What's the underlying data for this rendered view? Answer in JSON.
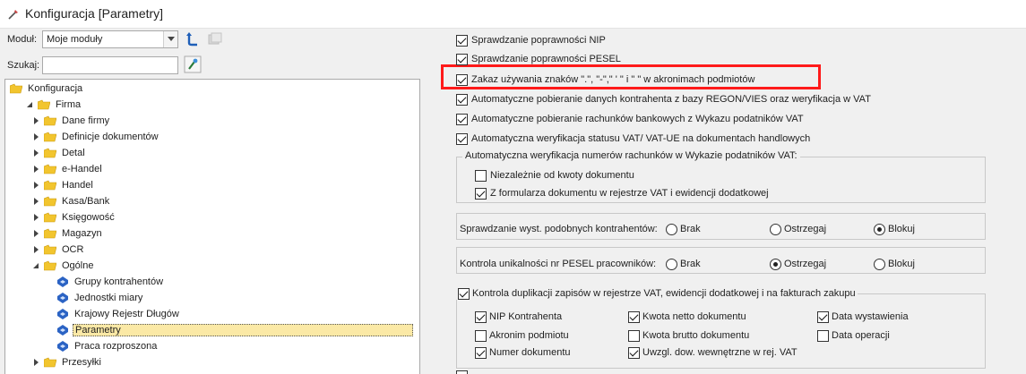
{
  "window": {
    "title": "Konfiguracja [Parametry]"
  },
  "toolbar": {
    "modul_label": "Moduł:",
    "modul_value": "Moje moduły",
    "szukaj_label": "Szukaj:",
    "szukaj_value": ""
  },
  "tree": {
    "items": [
      {
        "label": "Konfiguracja",
        "level": 0,
        "expander": "none",
        "icon": "folder"
      },
      {
        "label": "Firma",
        "level": 1,
        "expander": "expanded",
        "icon": "folder"
      },
      {
        "label": "Dane firmy",
        "level": 2,
        "expander": "collapsed",
        "icon": "folder"
      },
      {
        "label": "Definicje dokumentów",
        "level": 2,
        "expander": "collapsed",
        "icon": "folder"
      },
      {
        "label": "Detal",
        "level": 2,
        "expander": "collapsed",
        "icon": "folder"
      },
      {
        "label": "e-Handel",
        "level": 2,
        "expander": "collapsed",
        "icon": "folder"
      },
      {
        "label": "Handel",
        "level": 2,
        "expander": "collapsed",
        "icon": "folder"
      },
      {
        "label": "Kasa/Bank",
        "level": 2,
        "expander": "collapsed",
        "icon": "folder"
      },
      {
        "label": "Księgowość",
        "level": 2,
        "expander": "collapsed",
        "icon": "folder"
      },
      {
        "label": "Magazyn",
        "level": 2,
        "expander": "collapsed",
        "icon": "folder"
      },
      {
        "label": "OCR",
        "level": 2,
        "expander": "collapsed",
        "icon": "folder"
      },
      {
        "label": "Ogólne",
        "level": 2,
        "expander": "expanded",
        "icon": "folder"
      },
      {
        "label": "Grupy kontrahentów",
        "level": 3,
        "expander": "none",
        "icon": "leaf"
      },
      {
        "label": "Jednostki miary",
        "level": 3,
        "expander": "none",
        "icon": "leaf"
      },
      {
        "label": "Krajowy Rejestr Długów",
        "level": 3,
        "expander": "none",
        "icon": "leaf"
      },
      {
        "label": "Parametry",
        "level": 3,
        "expander": "none",
        "icon": "leaf",
        "selected": true
      },
      {
        "label": "Praca rozproszona",
        "level": 3,
        "expander": "none",
        "icon": "leaf"
      },
      {
        "label": "Przesyłki",
        "level": 2,
        "expander": "collapsed",
        "icon": "folder"
      }
    ]
  },
  "params": {
    "top": [
      {
        "label": "Sprawdzanie poprawności NIP",
        "checked": true
      },
      {
        "label": "Sprawdzanie poprawności PESEL",
        "checked": true
      },
      {
        "label": "Zakaz używania znaków \".\", \"-\",\" ' \" i \" \" w akronimach podmiotów",
        "checked": true,
        "highlighted": true
      },
      {
        "label": "Automatyczne pobieranie danych kontrahenta z bazy REGON/VIES oraz weryfikacja w VAT",
        "checked": true
      },
      {
        "label": "Automatyczne pobieranie rachunków bankowych z Wykazu podatników VAT",
        "checked": true
      },
      {
        "label": "Automatyczna weryfikacja statusu VAT/ VAT-UE na dokumentach handlowych",
        "checked": true
      }
    ],
    "auto_verify_group": {
      "title": "Automatyczna weryfikacja numerów rachunków w Wykazie podatników VAT:",
      "items": [
        {
          "label": "Niezależnie od kwoty dokumentu",
          "checked": false
        },
        {
          "label": "Z formularza dokumentu w rejestrze VAT i ewidencji dodatkowej",
          "checked": true
        }
      ]
    },
    "similar_contractors": {
      "label": "Sprawdzanie wyst. podobnych kontrahentów:",
      "options": [
        "Brak",
        "Ostrzegaj",
        "Blokuj"
      ],
      "selected": "Blokuj"
    },
    "pesel_unique": {
      "label": "Kontrola unikalności nr PESEL pracowników:",
      "options": [
        "Brak",
        "Ostrzegaj",
        "Blokuj"
      ],
      "selected": "Ostrzegaj"
    },
    "dup_control": {
      "label": "Kontrola duplikacji zapisów w rejestrze VAT, ewidencji dodatkowej i na fakturach zakupu",
      "checked": true,
      "items": [
        {
          "label": "NIP Kontrahenta",
          "checked": true
        },
        {
          "label": "Kwota netto dokumentu",
          "checked": true
        },
        {
          "label": "Data wystawienia",
          "checked": true
        },
        {
          "label": "Akronim podmiotu",
          "checked": false
        },
        {
          "label": "Kwota brutto dokumentu",
          "checked": false
        },
        {
          "label": "Data operacji",
          "checked": false
        },
        {
          "label": "Numer dokumentu",
          "checked": true
        },
        {
          "label": "Uwzgl. dow. wewnętrzne w rej. VAT",
          "checked": true
        }
      ]
    }
  },
  "colors": {
    "highlight_box": "#ff1a1a",
    "selection_bg": "#fbe9a6",
    "folder_yellow": "#f2c52e",
    "leaf_blue": "#2b63c4"
  }
}
